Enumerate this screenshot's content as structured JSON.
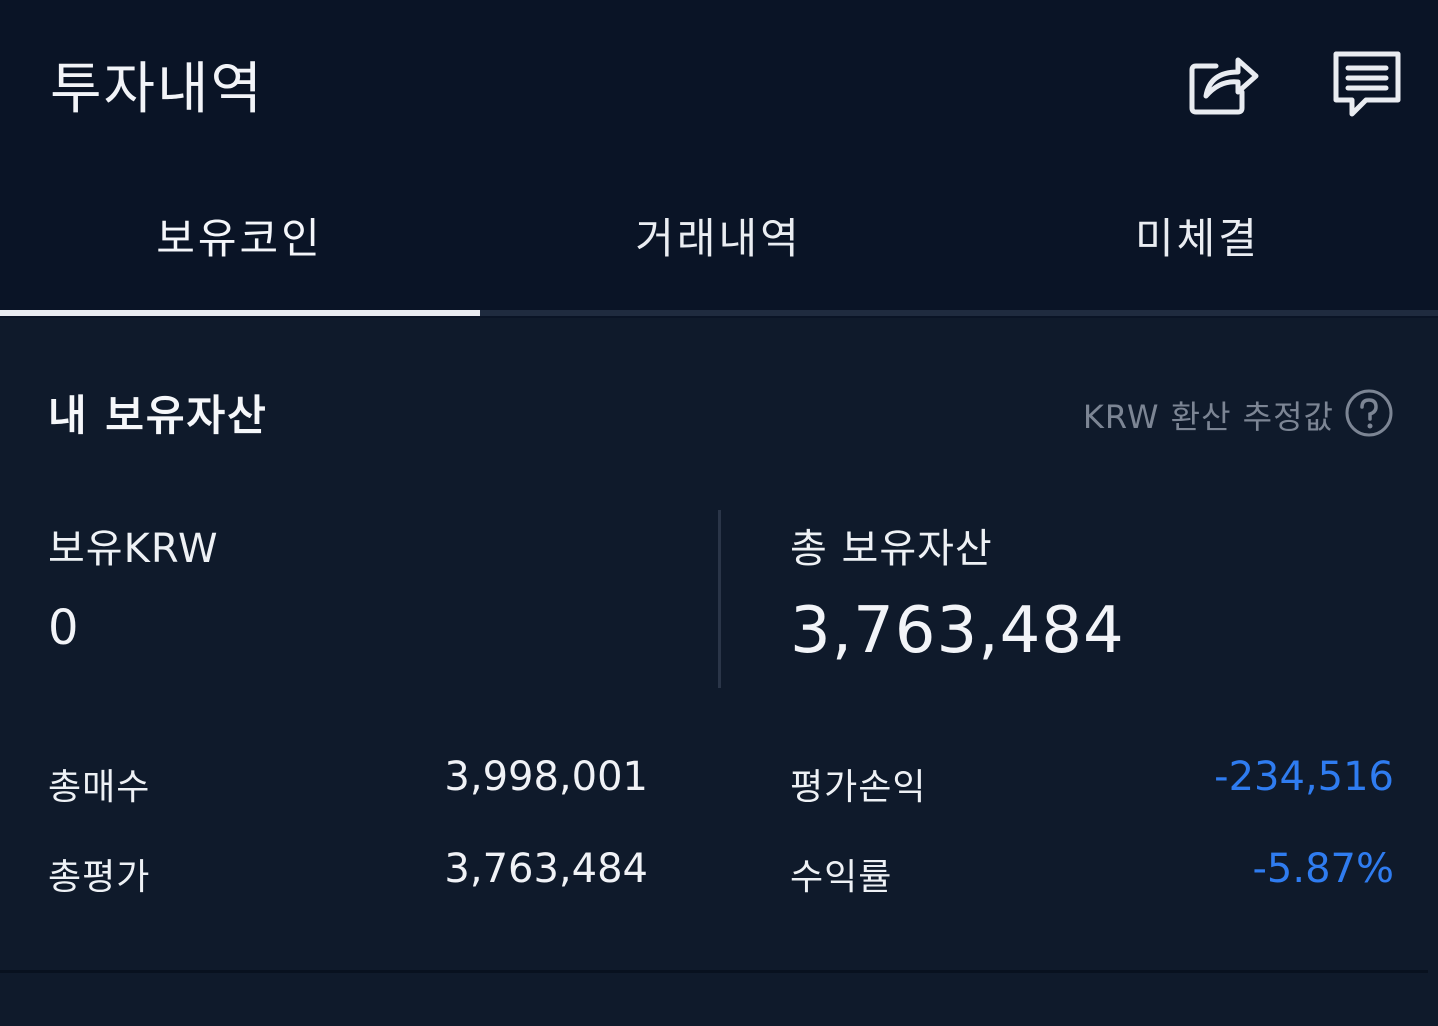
{
  "header": {
    "title": "투자내역",
    "share_icon": "share-icon",
    "chat_icon": "chat-icon"
  },
  "tabs": [
    {
      "label": "보유코인",
      "active": true
    },
    {
      "label": "거래내역",
      "active": false
    },
    {
      "label": "미체결",
      "active": false
    }
  ],
  "holdings": {
    "title": "내 보유자산",
    "krw_note": "KRW 환산 추정값",
    "help_icon": "question-circle-icon",
    "krw_label": "보유KRW",
    "krw_value": "0",
    "total_assets_label": "총 보유자산",
    "total_assets_value": "3,763,484",
    "rows": {
      "total_buy_label": "총매수",
      "total_buy_value": "3,998,001",
      "total_eval_label": "총평가",
      "total_eval_value": "3,763,484",
      "pnl_label": "평가손익",
      "pnl_value": "-234,516",
      "return_label": "수익률",
      "return_value": "-5.87%"
    }
  },
  "colors": {
    "background": "#0c1628",
    "negative": "#2f7cf0",
    "muted": "#7c8594"
  }
}
